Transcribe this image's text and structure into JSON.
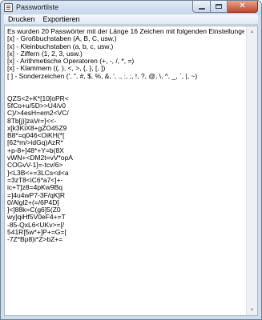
{
  "window": {
    "title": "Passwortliste",
    "icon": "notepad-list-icon",
    "controls": [
      "minimize-icon",
      "maximize-icon",
      "close-icon"
    ]
  },
  "menu": {
    "items": [
      "Drucken",
      "Exportieren"
    ]
  },
  "text": {
    "lines": [
      "Es wurden 20 Passwörter mit der Länge 16 Zeichen mit folgenden Einstellungen generiert:",
      "[x] - Großbuchstaben (A, B, C, usw.)",
      "[x] - Kleinbuchstaben (a, b, c, usw.)",
      "[x] - Ziffern (1, 2, 3, usw.)",
      "[x] - Arithmetische Operatoren (+, -, /, *, =)",
      "[x] - Klammern ((, ), <, >, {, }, [, ])",
      "[ ] - Sonderzeichen (', \", #, $, %, &, ', ., :, ;, !, ?, @, \\, ^, _, `, |, ~)",
      "",
      "",
      "QZS<2+K*[10[oPR<",
      "5fCo+u/5D>>U4/v0",
      "C)/>4esH=em2<VC/",
      "8Tb[j)]zaVr=]<<-",
      "x[k3KiX8+gZO45Z9",
      "B8*=q046<OiKH(*[",
      "[62*m/>idGq)AzR*",
      "+p-8+]48*+Y=b(8X",
      "vWN+<DM2t=vV*opA",
      "COGvV-1]=-tcv/6>",
      "]<L3B<+=3LCs<d<a",
      "=3zT8<iC6*a7<]+-",
      "ic+T]z8=4pKw9Bq",
      "=]4u4wP7-3F/qK]R",
      "0/Algl2+(=/6P4D]",
      "]<]88k=C(g6]5(Z0",
      "wy]qiHf5V0eF4+=T",
      "-85-QxL6<UKv>=[/",
      "541R[5w*+]P+=G=[",
      "-7Z*Bp8)i*Z>bZ+="
    ]
  }
}
